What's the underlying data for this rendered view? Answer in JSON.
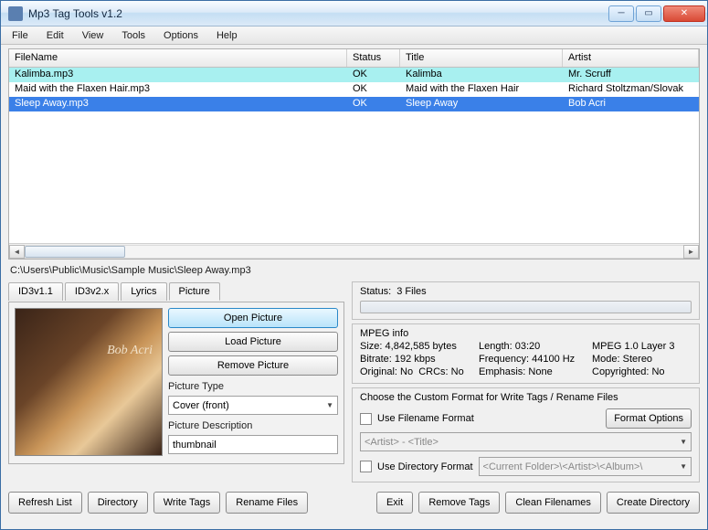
{
  "window": {
    "title": "Mp3 Tag Tools v1.2"
  },
  "menu": {
    "file": "File",
    "edit": "Edit",
    "view": "View",
    "tools": "Tools",
    "options": "Options",
    "help": "Help"
  },
  "columns": {
    "filename": "FileName",
    "status": "Status",
    "title": "Title",
    "artist": "Artist"
  },
  "rows": [
    {
      "filename": "Kalimba.mp3",
      "status": "OK",
      "title": "Kalimba",
      "artist": "Mr. Scruff"
    },
    {
      "filename": "Maid with the Flaxen Hair.mp3",
      "status": "OK",
      "title": "Maid with the Flaxen Hair",
      "artist": "Richard Stoltzman/Slovak"
    },
    {
      "filename": "Sleep Away.mp3",
      "status": "OK",
      "title": "Sleep Away",
      "artist": "Bob Acri"
    }
  ],
  "path": "C:\\Users\\Public\\Music\\Sample Music\\Sleep Away.mp3",
  "tabs": {
    "id3v11": "ID3v1.1",
    "id3v2x": "ID3v2.x",
    "lyrics": "Lyrics",
    "picture": "Picture"
  },
  "picture": {
    "open": "Open Picture",
    "load": "Load Picture",
    "remove": "Remove Picture",
    "type_label": "Picture Type",
    "type_value": "Cover (front)",
    "desc_label": "Picture Description",
    "desc_value": "thumbnail"
  },
  "status": {
    "label": "Status:",
    "value": "3 Files"
  },
  "mpeg": {
    "heading": "MPEG info",
    "size_label": "Size:",
    "size_value": "4,842,585 bytes",
    "length_label": "Length:",
    "length_value": "03:20",
    "layer_label": "MPEG 1.0 Layer 3",
    "bitrate_label": "Bitrate:",
    "bitrate_value": "192 kbps",
    "freq_label": "Frequency:",
    "freq_value": "44100 Hz",
    "mode_label": "Mode:",
    "mode_value": "Stereo",
    "orig_label": "Original:",
    "orig_value": "No",
    "crc_label": "CRCs:",
    "crc_value": "No",
    "emph_label": "Emphasis:",
    "emph_value": "None",
    "copy_label": "Copyrighted:",
    "copy_value": "No"
  },
  "format": {
    "heading": "Choose the Custom Format for Write Tags / Rename Files",
    "use_filename": "Use Filename Format",
    "options": "Format Options",
    "filename_tpl": "<Artist> - <Title>",
    "use_directory": "Use Directory Format",
    "directory_tpl": "<Current Folder>\\<Artist>\\<Album>\\"
  },
  "buttons": {
    "refresh": "Refresh List",
    "directory": "Directory",
    "write": "Write Tags",
    "rename": "Rename Files",
    "exit": "Exit",
    "remove": "Remove Tags",
    "clean": "Clean Filenames",
    "create": "Create Directory"
  }
}
